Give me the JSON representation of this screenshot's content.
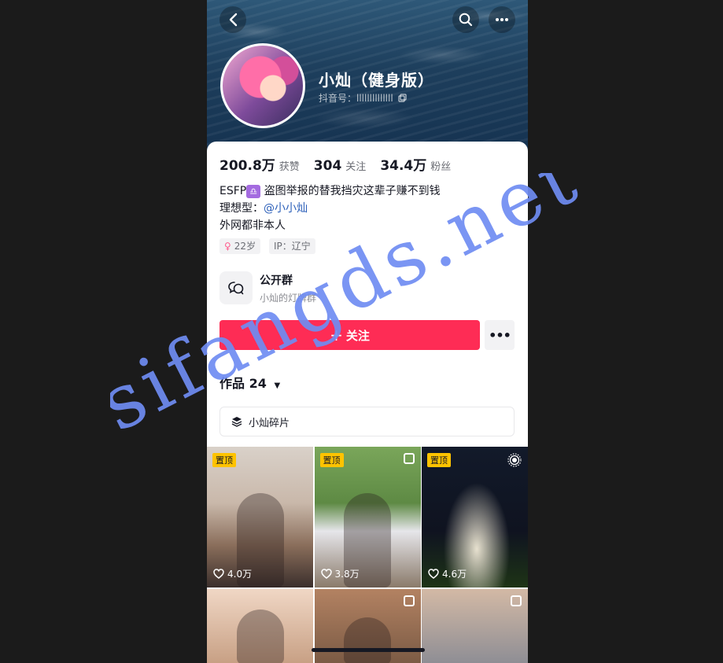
{
  "header": {
    "name": "小灿（健身版）",
    "douyin_id": "抖音号：llllllllllllll"
  },
  "stats": [
    {
      "value": "200.8万",
      "label": "获赞"
    },
    {
      "value": "304",
      "label": "关注"
    },
    {
      "value": "34.4万",
      "label": "粉丝"
    }
  ],
  "bio": {
    "line1_prefix": "ESFP",
    "line1_zodiac": "♎",
    "line1_text": "盗图举报的替我挡灾这辈子赚不到钱",
    "line2_prefix": "理想型：",
    "line2_mention": "@小小灿",
    "line3": "外网都非本人"
  },
  "tags": {
    "gender_icon": "♀",
    "age": "22岁",
    "ip": "IP：辽宁"
  },
  "group": {
    "title": "公开群",
    "subtitle": "小灿的灯牌群"
  },
  "actions": {
    "follow_plus": "+",
    "follow_label": "关注",
    "more_label": "•••"
  },
  "works": {
    "tab_label": "作品",
    "count": "24",
    "caret": "▼"
  },
  "collection": {
    "label": "小灿碎片"
  },
  "videos": [
    {
      "pinned": "置顶",
      "likes": "4.0万"
    },
    {
      "pinned": "置顶",
      "likes": "3.8万"
    },
    {
      "pinned": "置顶",
      "likes": "4.6万"
    },
    {
      "pinned": "",
      "likes": ""
    },
    {
      "pinned": "",
      "likes": ""
    },
    {
      "pinned": "",
      "likes": ""
    }
  ],
  "watermark": "sifangds.net"
}
